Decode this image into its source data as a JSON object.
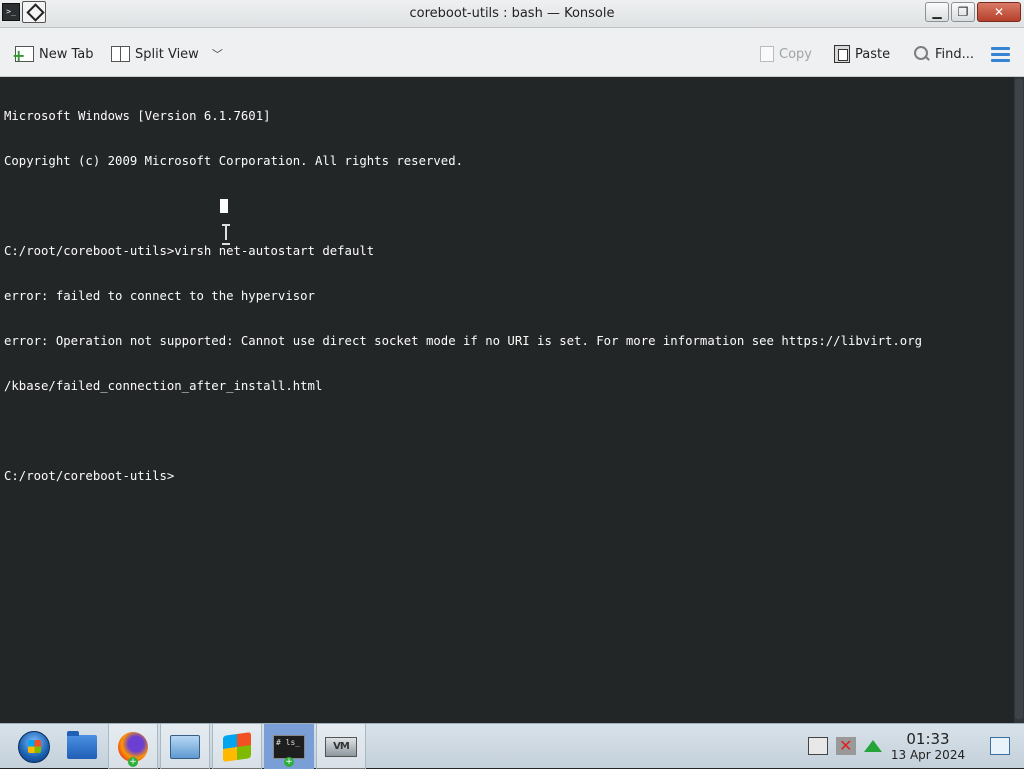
{
  "window": {
    "title": "coreboot-utils : bash — Konsole"
  },
  "toolbar": {
    "new_tab": "New Tab",
    "split_view": "Split View",
    "copy": "Copy",
    "paste": "Paste",
    "find": "Find..."
  },
  "terminal": {
    "lines": [
      "Microsoft Windows [Version 6.1.7601]",
      "Copyright (c) 2009 Microsoft Corporation. All rights reserved.",
      "",
      "C:/root/coreboot-utils>virsh net-autostart default",
      "error: failed to connect to the hypervisor",
      "error: Operation not supported: Cannot use direct socket mode if no URI is set. For more information see https://libvirt.org",
      "/kbase/failed_connection_after_install.html",
      "",
      "C:/root/coreboot-utils>"
    ]
  },
  "taskbar": {
    "items": [
      "start-orb",
      "file-explorer",
      "firefox",
      "remote-desktop",
      "windows",
      "konsole",
      "virtual-machine"
    ],
    "terminal_icon_text": "# ls_",
    "vm_icon_text": "VM"
  },
  "tray": {
    "time": "01:33",
    "date": "13 Apr 2024"
  },
  "colors": {
    "terminal_bg": "#232627",
    "terminal_fg": "#fcfcfc",
    "accent": "#3584d4"
  }
}
